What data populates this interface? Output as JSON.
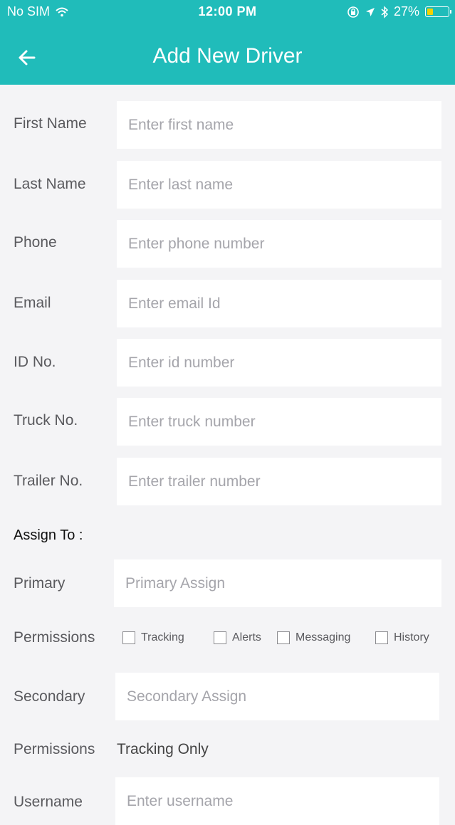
{
  "status_bar": {
    "carrier": "No SIM",
    "time": "12:00 PM",
    "battery": "27%",
    "battery_level": 0.27
  },
  "header": {
    "title": "Add New Driver"
  },
  "form": {
    "first_name": {
      "label": "First Name",
      "placeholder": "Enter first name"
    },
    "last_name": {
      "label": "Last Name",
      "placeholder": "Enter last name"
    },
    "phone": {
      "label": "Phone",
      "placeholder": "Enter phone number"
    },
    "email": {
      "label": "Email",
      "placeholder": "Enter email Id"
    },
    "id_no": {
      "label": "ID No.",
      "placeholder": "Enter id number"
    },
    "truck_no": {
      "label": "Truck No.",
      "placeholder": "Enter truck number"
    },
    "trailer_no": {
      "label": "Trailer No.",
      "placeholder": "Enter trailer number"
    },
    "assign_to": "Assign To :",
    "primary": {
      "label": "Primary",
      "placeholder": "Primary Assign"
    },
    "primary_permissions": {
      "label": "Permissions",
      "options": [
        "Tracking",
        "Alerts",
        "Messaging",
        "History"
      ]
    },
    "secondary": {
      "label": "Secondary",
      "placeholder": "Secondary Assign"
    },
    "secondary_permissions": {
      "label": "Permissions",
      "value": "Tracking Only"
    },
    "username": {
      "label": "Username",
      "placeholder": "Enter username"
    }
  }
}
